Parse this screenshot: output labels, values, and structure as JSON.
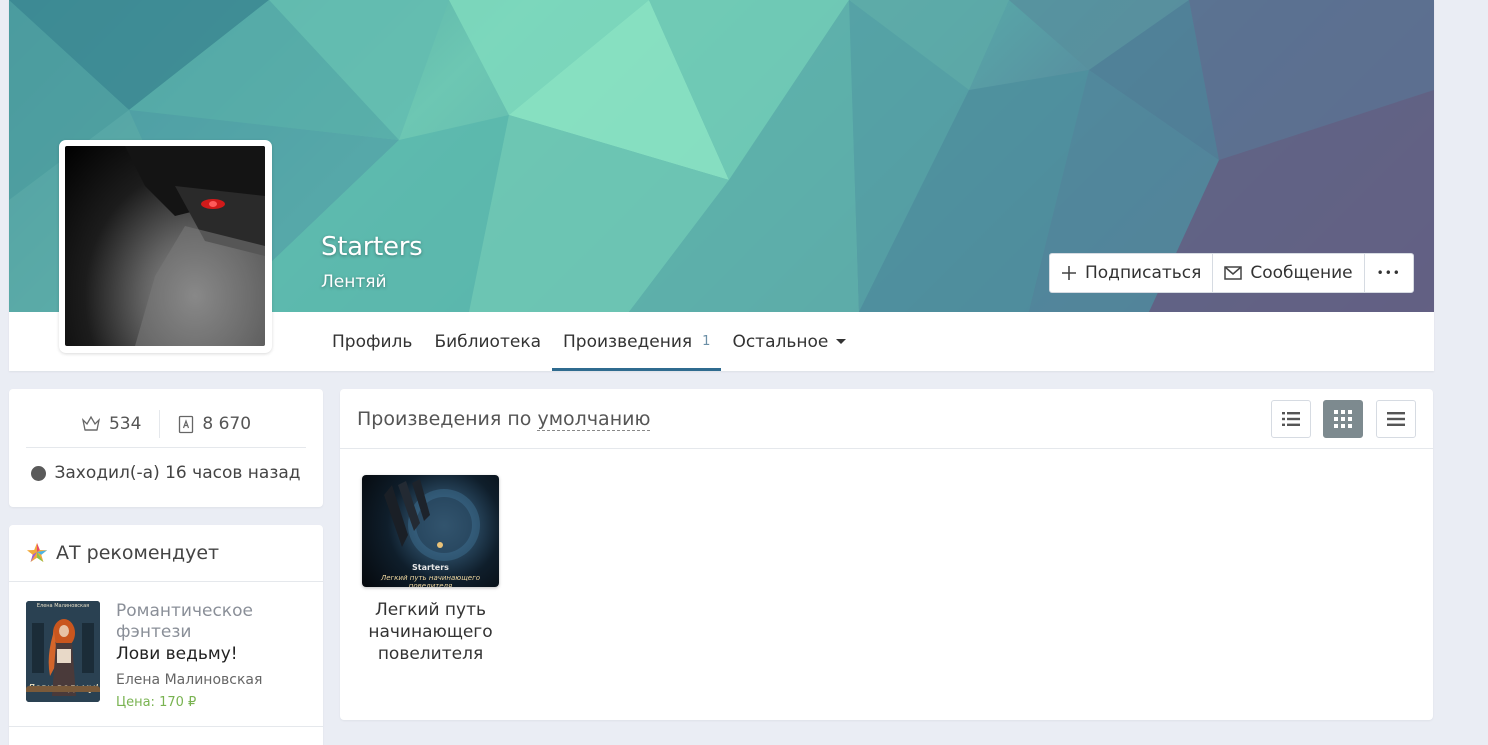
{
  "profile": {
    "name": "Starters",
    "status": "Лентяй"
  },
  "actions": {
    "subscribe": "Подписаться",
    "message": "Сообщение",
    "more": "•••"
  },
  "tabs": [
    {
      "label": "Профиль"
    },
    {
      "label": "Библиотека"
    },
    {
      "label": "Произведения",
      "count": "1",
      "active": true
    },
    {
      "label": "Остальное"
    }
  ],
  "stats": {
    "rating": "534",
    "views": "8 670",
    "last_seen": "Заходил(-а) 16 часов назад"
  },
  "recommend": {
    "title": "АТ рекомендует",
    "items": [
      {
        "genre": "Романтическое фэнтези",
        "title": "Лови ведьму!",
        "author": "Елена Малиновская",
        "price": "Цена: 170 ₽",
        "cover_author": "Елена Малиновская",
        "cover_title": "Лови ведьму!"
      }
    ]
  },
  "works": {
    "heading_prefix": "Произведения по",
    "sort_label": "умолчанию",
    "view_modes": [
      "list-view-icon",
      "grid-view-icon",
      "compact-view-icon"
    ],
    "active_view": "grid-view-icon",
    "items": [
      {
        "title": "Легкий путь начинающего повелителя",
        "cover_author": "Starters",
        "cover_title": "Легкий путь начинающего повелителя"
      }
    ]
  },
  "colors": {
    "tab_underline": "#2f6b8f",
    "price": "#79b351",
    "active_view_bg": "#7d8a8f"
  }
}
